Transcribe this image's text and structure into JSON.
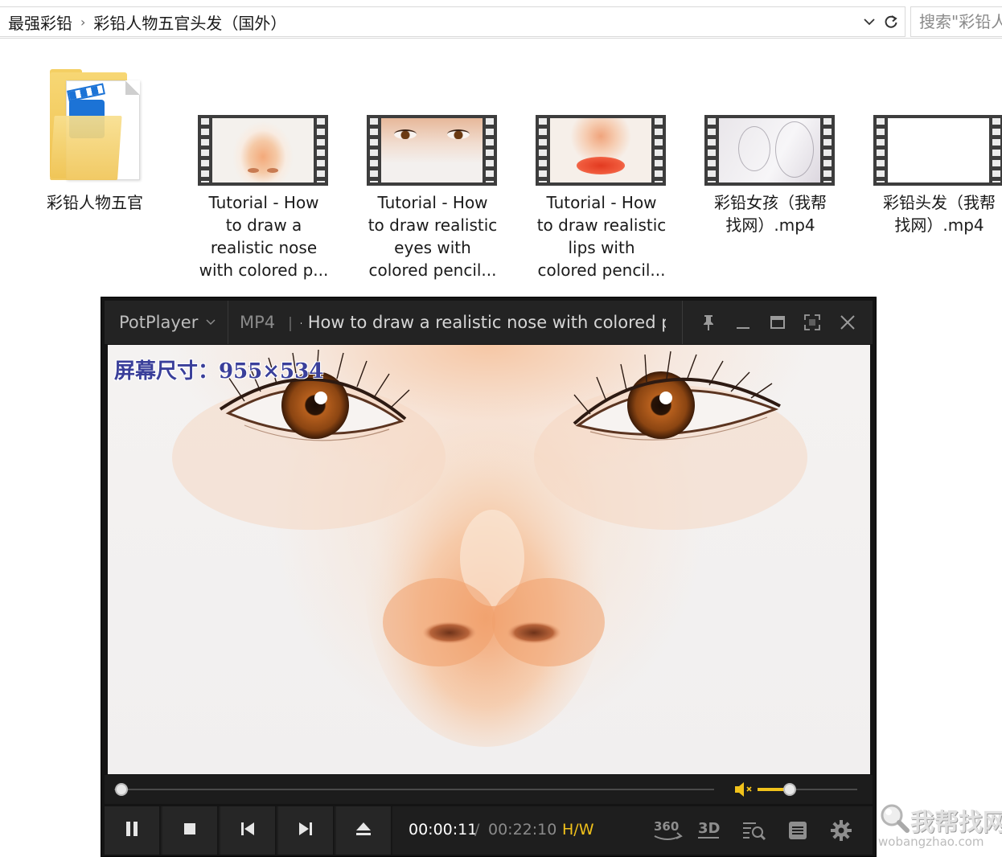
{
  "breadcrumb": {
    "items": [
      "最强彩铅",
      "彩铅人物五官头发（国外）"
    ],
    "separator": "›"
  },
  "search": {
    "placeholder": "搜索\"彩铅人物五官头发（国外）\""
  },
  "files": [
    {
      "label_lines": [
        "彩铅人物五官"
      ],
      "type": "folder"
    },
    {
      "label_lines": [
        "Tutorial - How",
        "to draw a",
        "realistic nose",
        "with colored p..."
      ],
      "type": "video",
      "thumb": "nose"
    },
    {
      "label_lines": [
        "Tutorial - How",
        "to draw realistic",
        "eyes with",
        "colored pencil..."
      ],
      "type": "video",
      "thumb": "eyes"
    },
    {
      "label_lines": [
        "Tutorial - How",
        "to draw realistic",
        "lips with",
        "colored pencil..."
      ],
      "type": "video",
      "thumb": "lips"
    },
    {
      "label_lines": [
        "彩铅女孩（我帮",
        "找网）.mp4"
      ],
      "type": "video",
      "thumb": "sketch"
    },
    {
      "label_lines": [
        "彩铅头发（我帮",
        "找网）.mp4"
      ],
      "type": "video",
      "thumb": "blank"
    }
  ],
  "player": {
    "brand": "PotPlayer",
    "format": "MP4",
    "title": "l - How to draw a realistic nose with colored pe",
    "overlay_text": "屏幕尺寸：955×534",
    "time_current": "00:00:11",
    "time_separator": "/",
    "time_total": "00:22:10",
    "aspect_label": "H/W",
    "seek_progress": 0.012,
    "volume_level": 0.32,
    "accent_color": "#f1c21b",
    "icons": {
      "pause": "pause-icon",
      "stop": "stop-icon",
      "prev": "previous-icon",
      "next": "next-icon",
      "eject": "eject-icon",
      "vr360": "360-icon",
      "three_d": "3d-icon",
      "playlist_search": "playlist-search-icon",
      "menu": "menu-icon",
      "settings": "gear-icon"
    },
    "icon_labels": {
      "vr360": "360",
      "three_d": "3D"
    }
  },
  "watermark": {
    "main": "我帮找网",
    "sub": "wobangzhao.com"
  }
}
